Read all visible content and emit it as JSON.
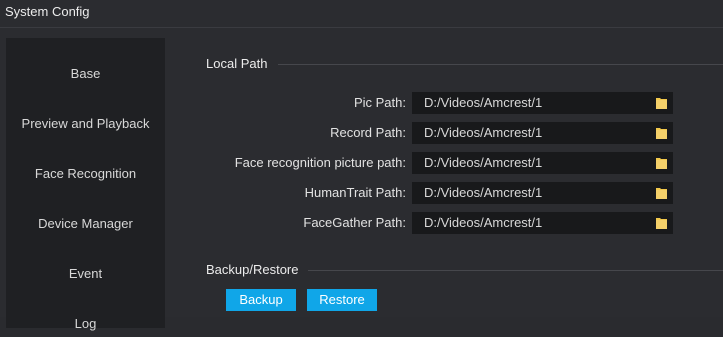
{
  "window": {
    "title": "System Config"
  },
  "sidebar": {
    "items": [
      {
        "label": "Base"
      },
      {
        "label": "Preview and Playback"
      },
      {
        "label": "Face Recognition"
      },
      {
        "label": "Device Manager"
      },
      {
        "label": "Event"
      },
      {
        "label": "Log"
      }
    ]
  },
  "local_path": {
    "title": "Local Path",
    "rows": [
      {
        "label": "Pic Path:",
        "value": "D:/Videos/Amcrest/1",
        "icon": "folder-icon"
      },
      {
        "label": "Record Path:",
        "value": "D:/Videos/Amcrest/1",
        "icon": "folder-icon"
      },
      {
        "label": "Face recognition picture path:",
        "value": "D:/Videos/Amcrest/1",
        "icon": "folder-icon"
      },
      {
        "label": "HumanTrait Path:",
        "value": "D:/Videos/Amcrest/1",
        "icon": "folder-icon"
      },
      {
        "label": "FaceGather Path:",
        "value": "D:/Videos/Amcrest/1",
        "icon": "folder-icon"
      }
    ]
  },
  "backup_restore": {
    "title": "Backup/Restore",
    "backup_label": "Backup",
    "restore_label": "Restore"
  },
  "colors": {
    "accent": "#10a6e8",
    "folder": "#f2c94c",
    "background": "#2b2c30",
    "sidebar": "#1f2023",
    "field": "#18191b"
  }
}
